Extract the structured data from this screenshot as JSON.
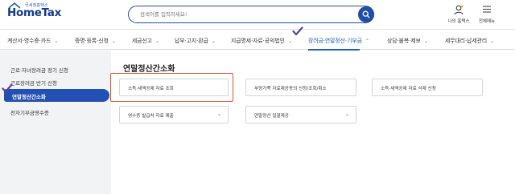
{
  "header": {
    "logo_small": "국세청홈택스",
    "logo_main": "HomeTax",
    "search_placeholder": "검색어를 입력하세요!",
    "my_hometax_label": "나의 홈택스",
    "all_menu_label": "전체메뉴"
  },
  "nav": {
    "items": [
      {
        "label": "계산서·영수증·카드"
      },
      {
        "label": "증명·등록·신청"
      },
      {
        "label": "세금신고"
      },
      {
        "label": "납부·고지·환급"
      },
      {
        "label": "지급명세·자료·공익법인"
      },
      {
        "label": "장려금·연말정산·기부금"
      },
      {
        "label": "상담·불복·제보"
      },
      {
        "label": "세무대리·납세관리"
      }
    ],
    "active_index": 5
  },
  "sidebar": {
    "items": [
      {
        "label": "근로·자녀장려금 정기 신청"
      },
      {
        "label": "근로장려금 반기 신청"
      },
      {
        "label": "연말정산간소화"
      },
      {
        "label": "전자기부금영수증"
      }
    ],
    "active_index": 2
  },
  "main": {
    "title": "연말정산간소화",
    "cards": [
      {
        "label": "소득·세액공제 자료 조회"
      },
      {
        "label": "부양가족 자료제공동의 신청/조회/취소"
      },
      {
        "label": "소득·세액공제 자료 삭제 신청"
      },
      {
        "label": "영수증 발급처 자료 제출"
      },
      {
        "label": "연말정산 일괄제공"
      }
    ]
  },
  "colors": {
    "brand_blue": "#1e4ea6",
    "highlight": "#e8532a",
    "check_purple": "#5b3fa8"
  }
}
